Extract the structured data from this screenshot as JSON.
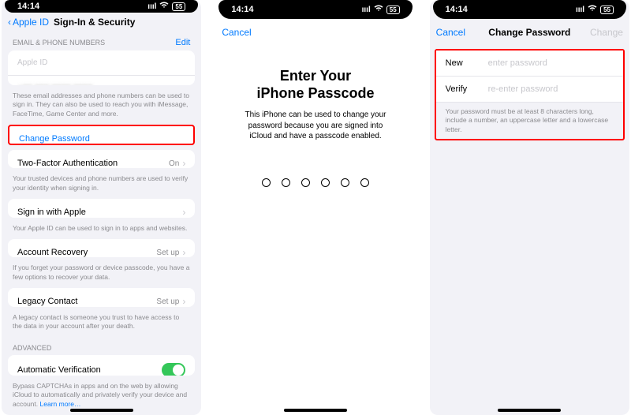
{
  "status": {
    "time": "14:14",
    "signal": "▮▮▮▮",
    "wifi": "▲",
    "battery": "55"
  },
  "p1": {
    "back": "Apple ID",
    "title": "Sign-In & Security",
    "emailHeader": "EMAIL & PHONE NUMBERS",
    "edit": "Edit",
    "appleId": "Apple ID",
    "phone": "+## ### #### ####",
    "emailDesc": "These email addresses and phone numbers can be used to sign in. They can also be used to reach you with iMessage, FaceTime, Game Center and more.",
    "changePassword": "Change Password",
    "twoFactor": "Two-Factor Authentication",
    "twoFactorValue": "On",
    "twoFactorDesc": "Your trusted devices and phone numbers are used to verify your identity when signing in.",
    "siwa": "Sign in with Apple",
    "siwaDesc": "Your Apple ID can be used to sign in to apps and websites.",
    "recovery": "Account Recovery",
    "setup": "Set up",
    "recoveryDesc": "If you forget your password or device passcode, you have a few options to recover your data.",
    "legacy": "Legacy Contact",
    "legacyDesc": "A legacy contact is someone you trust to have access to the data in your account after your death.",
    "advanced": "ADVANCED",
    "autoVerify": "Automatic Verification",
    "autoVerifyDesc": "Bypass CAPTCHAs in apps and on the web by allowing iCloud to automatically and privately verify your device and account.",
    "learnMore": "Learn more…"
  },
  "p2": {
    "cancel": "Cancel",
    "titleLine1": "Enter Your",
    "titleLine2": "iPhone Passcode",
    "desc": "This iPhone can be used to change your password because you are signed into iCloud and have a passcode enabled."
  },
  "p3": {
    "cancel": "Cancel",
    "title": "Change Password",
    "action": "Change",
    "newLabel": "New",
    "newPlaceholder": "enter password",
    "verifyLabel": "Verify",
    "verifyPlaceholder": "re-enter password",
    "req": "Your password must be at least 8 characters long, include a number, an uppercase letter and a lowercase letter."
  }
}
